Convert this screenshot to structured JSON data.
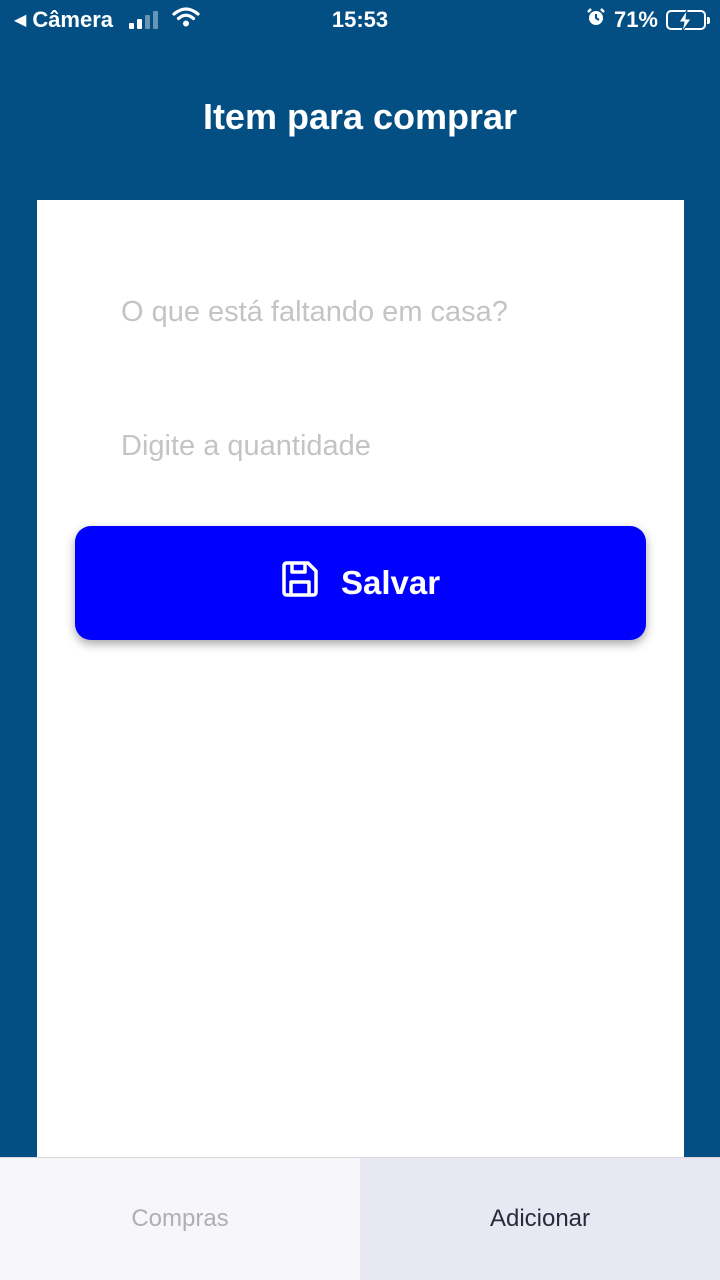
{
  "status_bar": {
    "back_app": "Câmera",
    "time": "15:53",
    "battery_percent": "71%",
    "battery_level": 0.71
  },
  "header": {
    "title": "Item para comprar"
  },
  "form": {
    "item_placeholder": "O que está faltando em casa?",
    "quantity_placeholder": "Digite a quantidade",
    "save_label": "Salvar"
  },
  "tabs": [
    {
      "label": "Compras",
      "active": false
    },
    {
      "label": "Adicionar",
      "active": true
    }
  ],
  "colors": {
    "header_bg": "#034F84",
    "button_bg": "#0000FF",
    "card_bg": "#FFFFFF",
    "placeholder": "#C4C4C6"
  }
}
